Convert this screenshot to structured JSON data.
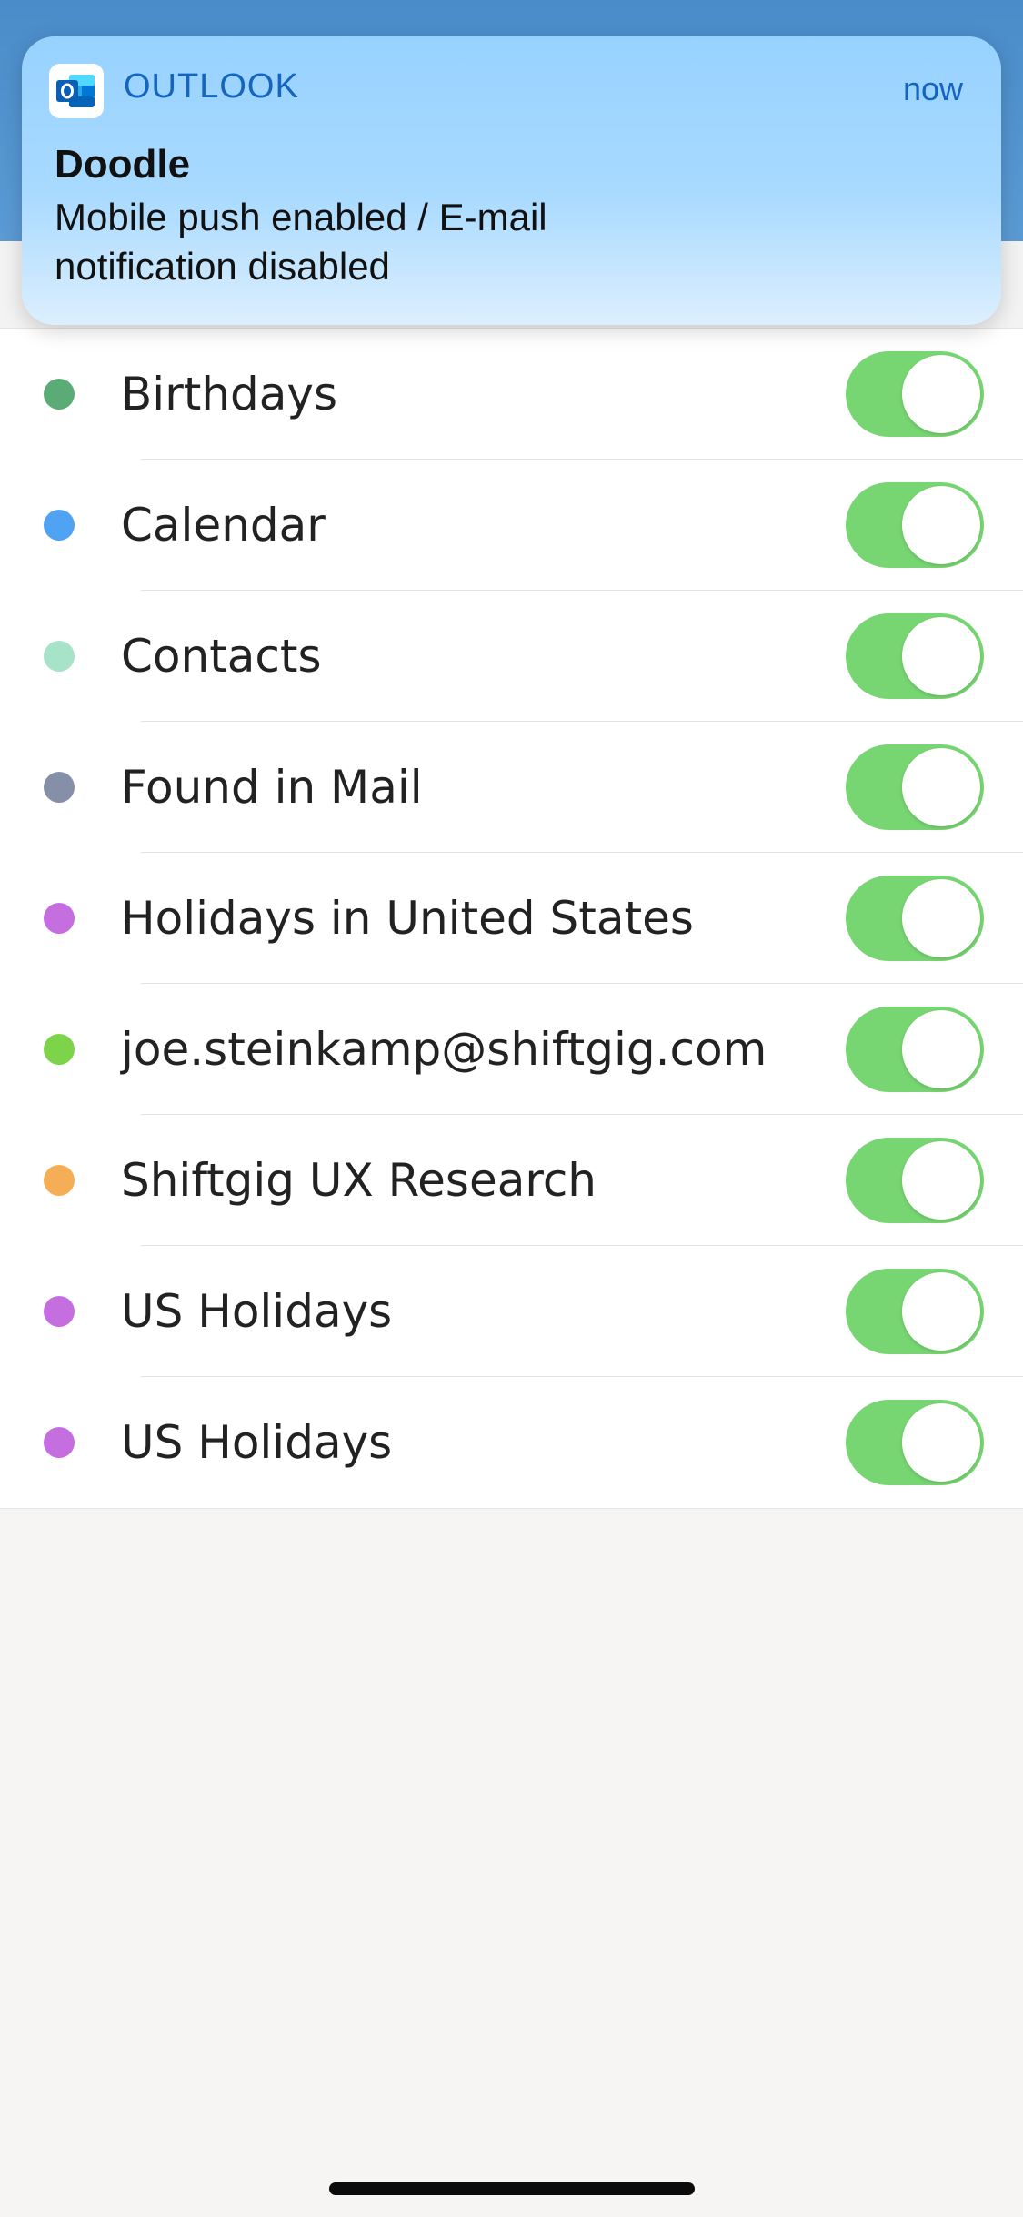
{
  "notification": {
    "app_name": "OUTLOOK",
    "time": "now",
    "title": "Doodle",
    "body": "Mobile push enabled / E-mail notification disabled",
    "app_icon": "outlook-icon"
  },
  "calendars": [
    {
      "name": "Birthdays",
      "color": "#5bab76",
      "enabled": true
    },
    {
      "name": "Calendar",
      "color": "#4fa3f2",
      "enabled": true
    },
    {
      "name": "Contacts",
      "color": "#a6e3c8",
      "enabled": true
    },
    {
      "name": "Found in Mail",
      "color": "#8590a8",
      "enabled": true
    },
    {
      "name": "Holidays in United States",
      "color": "#c46ee0",
      "enabled": true
    },
    {
      "name": "joe.steinkamp@shiftgig.com",
      "color": "#7dd349",
      "enabled": true
    },
    {
      "name": "Shiftgig UX Research",
      "color": "#f5ae56",
      "enabled": true
    },
    {
      "name": "US Holidays",
      "color": "#c46ee0",
      "enabled": true
    },
    {
      "name": "US Holidays",
      "color": "#c46ee0",
      "enabled": true
    }
  ],
  "colors": {
    "toggle_on": "#78d672",
    "notification_accent": "#1565c0"
  }
}
